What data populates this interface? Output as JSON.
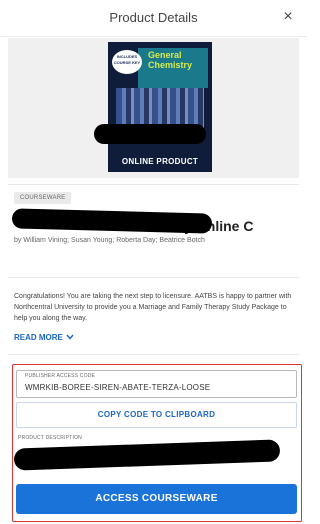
{
  "header": {
    "title": "Product Details",
    "close_symbol": "×"
  },
  "cover": {
    "badge_text": "INCLUDES COURSE KEY",
    "title_text": "General Chemistry",
    "footer_text": "ONLINE PRODUCT"
  },
  "product": {
    "tag": "COURSEWARE",
    "title_visible": "mistry Online C",
    "authors": "by William Vining; Susan Young; Roberta Day; Beatrice Botch"
  },
  "description": "Congratulations! You are taking the next step to licensure. AATBS is happy to partner with Northcentral University to provide you a Marriage and Family Therapy Study Package to help you along the way.",
  "read_more": {
    "label": "READ MORE",
    "icon": "chevron-down-icon"
  },
  "access_code": {
    "label": "PUBLISHER ACCESS CODE",
    "value": "WMRKIB-BOREE-SIREN-ABATE-TERZA-LOOSE"
  },
  "copy_button": {
    "label": "COPY CODE TO CLIPBOARD"
  },
  "product_description": {
    "label": "PRODUCT DESCRIPTION"
  },
  "access_button": {
    "label": "ACCESS COURSEWARE"
  },
  "colors": {
    "accent": "#1a73d9",
    "link": "#1a66c9",
    "highlight_outline": "#dd3333",
    "redaction": "#000000"
  }
}
